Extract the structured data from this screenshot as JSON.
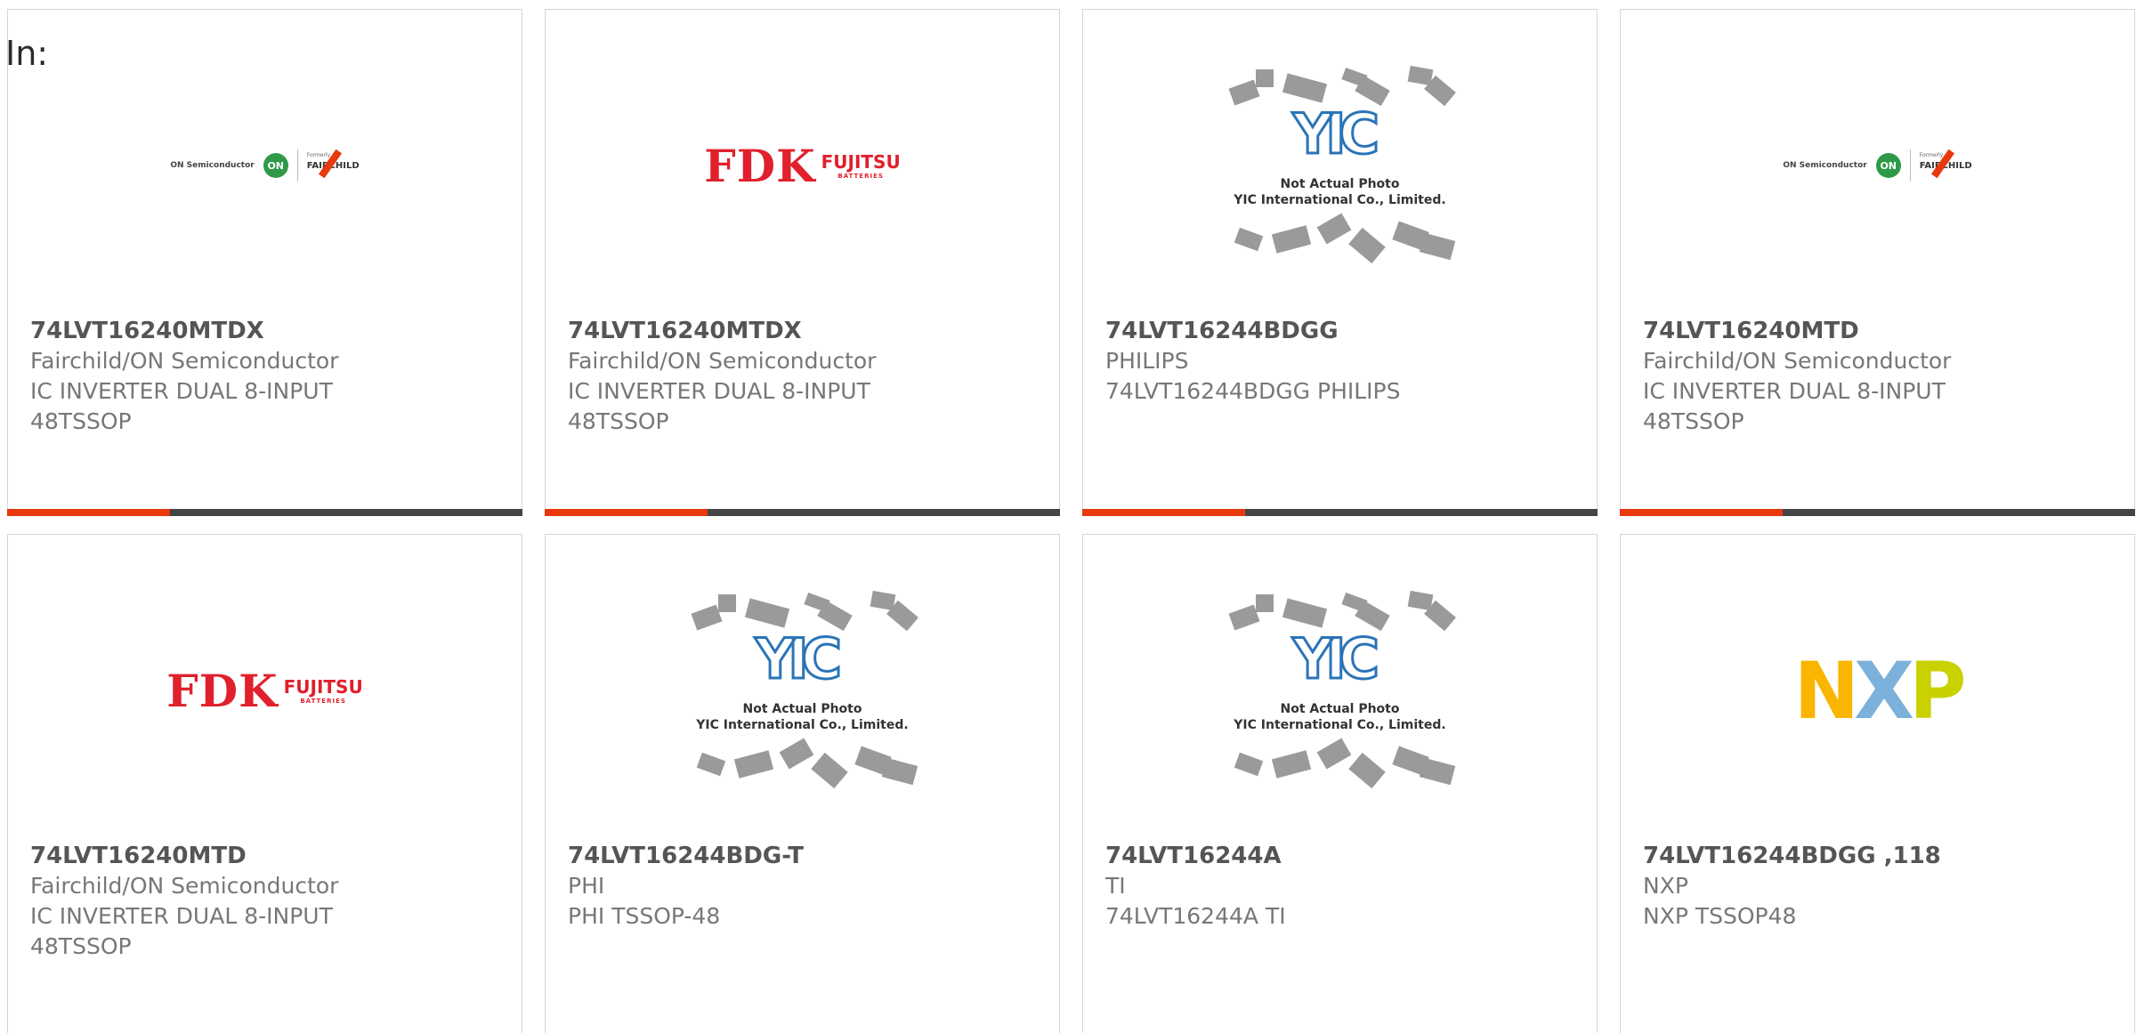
{
  "filter_label": "In:",
  "cards": [
    {
      "part": "74LVT16240MTDX",
      "manufacturer": "Fairchild/ON Semiconductor",
      "desc1": "IC INVERTER DUAL 8-INPUT",
      "desc2": "48TSSOP",
      "logo": "fairchild-on-logo",
      "logo_text": {
        "on": "ON Semiconductor",
        "badge": "ON",
        "formerly": "Formerly",
        "brand": "FAIRCHILD"
      }
    },
    {
      "part": "74LVT16240MTDX",
      "manufacturer": "Fairchild/ON Semiconductor",
      "desc1": "IC INVERTER DUAL 8-INPUT",
      "desc2": "48TSSOP",
      "logo": "fdk-fujitsu-logo",
      "logo_text": {
        "fdk": "FDK",
        "fujitsu": "FUJITSU",
        "batteries": "BATTERIES"
      }
    },
    {
      "part": "74LVT16244BDGG",
      "manufacturer": "PHILIPS",
      "desc1": "74LVT16244BDGG PHILIPS",
      "desc2": "",
      "logo": "yic-placeholder-logo",
      "logo_text": {
        "mark": "YIC",
        "line1": "Not Actual Photo",
        "line2": "YIC International Co., Limited."
      }
    },
    {
      "part": "74LVT16240MTD",
      "manufacturer": "Fairchild/ON Semiconductor",
      "desc1": "IC INVERTER DUAL 8-INPUT",
      "desc2": "48TSSOP",
      "logo": "fairchild-on-logo",
      "logo_text": {
        "on": "ON Semiconductor",
        "badge": "ON",
        "formerly": "Formerly",
        "brand": "FAIRCHILD"
      }
    },
    {
      "part": "74LVT16240MTD",
      "manufacturer": "Fairchild/ON Semiconductor",
      "desc1": "IC INVERTER DUAL 8-INPUT",
      "desc2": "48TSSOP",
      "logo": "fdk-fujitsu-logo",
      "logo_text": {
        "fdk": "FDK",
        "fujitsu": "FUJITSU",
        "batteries": "BATTERIES"
      }
    },
    {
      "part": "74LVT16244BDG-T",
      "manufacturer": "PHI",
      "desc1": "PHI TSSOP-48",
      "desc2": "",
      "logo": "yic-placeholder-logo",
      "logo_text": {
        "mark": "YIC",
        "line1": "Not Actual Photo",
        "line2": "YIC International Co., Limited."
      }
    },
    {
      "part": "74LVT16244A",
      "manufacturer": "TI",
      "desc1": "74LVT16244A TI",
      "desc2": "",
      "logo": "yic-placeholder-logo",
      "logo_text": {
        "mark": "YIC",
        "line1": "Not Actual Photo",
        "line2": "YIC International Co., Limited."
      }
    },
    {
      "part": "74LVT16244BDGG ,118",
      "manufacturer": "NXP",
      "desc1": "NXP TSSOP48",
      "desc2": "",
      "logo": "nxp-logo",
      "logo_text": {
        "n": "N",
        "x": "X",
        "p": "P"
      }
    }
  ],
  "colors": {
    "accent_bar": "#e8380d",
    "dark_bar": "#444444",
    "fdk_red": "#e0202c",
    "on_green": "#2e9a48",
    "yic_blue": "#2a74b8"
  }
}
